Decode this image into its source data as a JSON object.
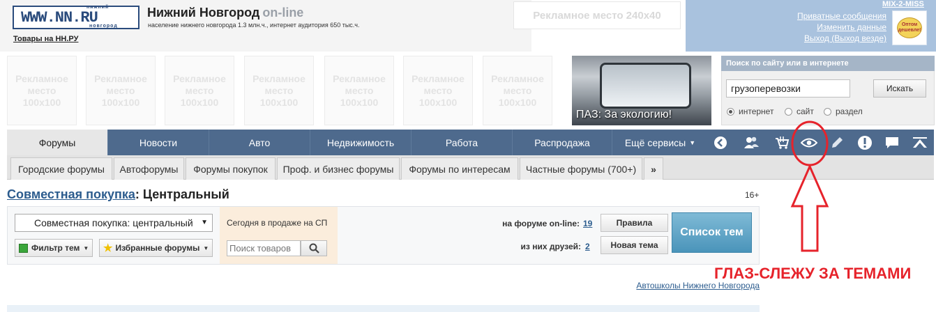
{
  "header": {
    "logo_small_top": "нижний",
    "logo_text": "WWW.NN.RU",
    "logo_small_bottom": "новгород",
    "site_title": "Нижний Новгород",
    "site_title_suffix": "on-line",
    "site_subtitle": "население нижнего новгорода 1.3 млн.ч., интернет аудитория 650 тыс.ч.",
    "goods_link": "Товары на НН.РУ",
    "ad_banner": "Рекламное место 240x40"
  },
  "user": {
    "name": "MIX-2-MISS",
    "links": [
      "Приватные сообщения",
      "Изменить данные",
      "Выход (Выход везде)"
    ],
    "avatar_text": "Оптом дешевле!"
  },
  "ads": {
    "square_label": "Рекламное место 100x100",
    "promo_caption": "ПАЗ: За экологию!"
  },
  "search": {
    "title": "Поиск по сайту или в интернете",
    "value": "грузоперевозки",
    "button": "Искать",
    "options": [
      "интернет",
      "сайт",
      "раздел"
    ],
    "selected": "интернет"
  },
  "nav": {
    "tabs": [
      "Форумы",
      "Новости",
      "Авто",
      "Недвижимость",
      "Работа",
      "Распродажа",
      "Ещё сервисы"
    ],
    "active": "Форумы",
    "icons": [
      "back-arrow-icon",
      "friends-icon",
      "basket-icon",
      "eye-icon",
      "pencil-icon",
      "warning-icon",
      "message-icon",
      "up-icon"
    ]
  },
  "subnav": {
    "tabs": [
      "Городские форумы",
      "Автофорумы",
      "Форумы покупок",
      "Проф. и бизнес форумы",
      "Форумы по интересам",
      "Частные форумы (700+)"
    ],
    "more": "»"
  },
  "page": {
    "title_link": "Совместная покупка",
    "title_rest": ": Центральный",
    "age": "16+"
  },
  "panel": {
    "forum_select": "Совместная покупка: центральный",
    "filter_button": "Фильтр тем",
    "favorites_button": "Избранные форумы",
    "sale_title": "Сегодня в продаже на СП",
    "goods_placeholder": "Поиск товаров",
    "online_label": "на форуме on-line:",
    "online_value": "19",
    "friends_label": "из них друзей:",
    "friends_value": "2",
    "rules_button": "Правила",
    "new_topic_button": "Новая тема",
    "topics_button": "Список тем"
  },
  "footer_link": "Автошколы Нижнего Новгорода",
  "annotation": "ГЛАЗ-СЛЕЖУ ЗА ТЕМАМИ",
  "colors": {
    "nav": "#4e6a8d",
    "annotation": "#e6232b",
    "link": "#2c5c8e"
  }
}
